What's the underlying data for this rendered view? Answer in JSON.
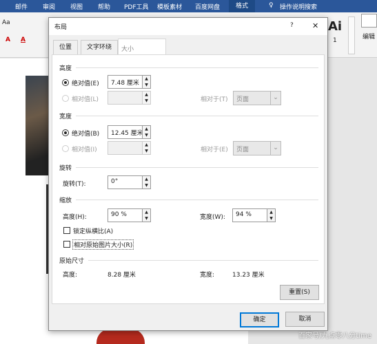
{
  "menubar": {
    "items": [
      "邮件",
      "审阅",
      "视图",
      "帮助",
      "PDF工具",
      "模板素材",
      "百度网盘",
      "格式",
      "操作说明搜索"
    ],
    "active": "格式"
  },
  "ribbon": {
    "font_size_label": "Aa",
    "styles_label": "Ai",
    "styles_num": "1",
    "edit_label": "编辑"
  },
  "dialog": {
    "title": "布局",
    "help": "?",
    "close": "✕",
    "tabs": [
      "位置",
      "文字环绕",
      "大小"
    ],
    "active_tab": "大小",
    "height": {
      "heading": "高度",
      "absolute_label": "绝对值(E)",
      "absolute_value": "7.48 厘米",
      "relative_label": "相对值(L)",
      "relative_to_label": "相对于(T)",
      "relative_to_value": "页面"
    },
    "width": {
      "heading": "宽度",
      "absolute_label": "绝对值(B)",
      "absolute_value": "12.45 厘米",
      "relative_label": "相对值(I)",
      "relative_to_label": "相对于(E)",
      "relative_to_value": "页面"
    },
    "rotation": {
      "heading": "旋转",
      "label": "旋转(T):",
      "value": "0°"
    },
    "scale": {
      "heading": "缩放",
      "height_label": "高度(H):",
      "height_value": "90 %",
      "width_label": "宽度(W):",
      "width_value": "94 %",
      "lock_aspect": "锁定纵横比(A)",
      "lock_aspect_checked": false,
      "relative_original": "相对原始图片大小(R)",
      "relative_original_checked": false
    },
    "original": {
      "heading": "原始尺寸",
      "height_label": "高度:",
      "height_value": "8.28 厘米",
      "width_label": "宽度:",
      "width_value": "13.23 厘米"
    },
    "reset": "重置(S)",
    "ok": "确定",
    "cancel": "取消"
  },
  "watermark": "百家号/九点零八分time",
  "colors": {
    "menubar": "#2b579a",
    "accent": "#0078d7"
  }
}
